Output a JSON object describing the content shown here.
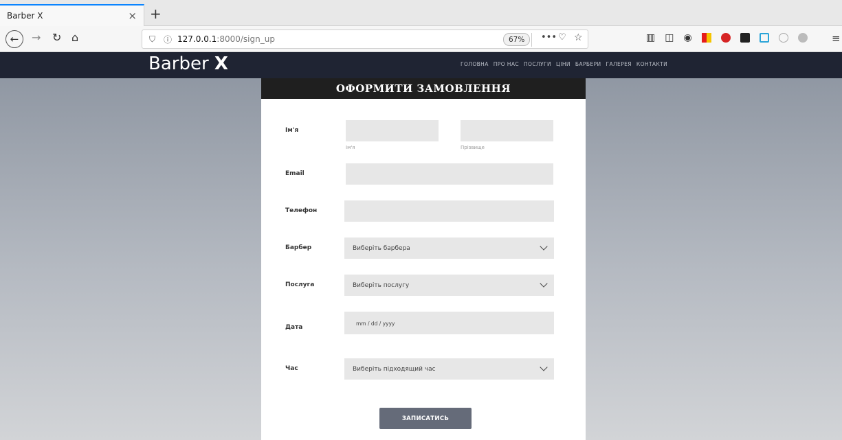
{
  "browser": {
    "tab_title": "Barber X",
    "tab_close": "×",
    "new_tab": "+",
    "url_host": "127.0.0.1",
    "url_path": ":8000/sign_up",
    "zoom": "67%"
  },
  "site": {
    "logo_text": "Barber",
    "logo_mark": "X",
    "nav": [
      "ГОЛОВНА",
      "ПРО НАС",
      "ПОСЛУГИ",
      "ЦІНИ",
      "БАРБЕРИ",
      "ГАЛЕРЕЯ",
      "КОНТАКТИ"
    ]
  },
  "form": {
    "title": "ОФОРМИТИ ЗАМОВЛЕННЯ",
    "name_label": "Ім'я",
    "first_name_hint": "Ім'я",
    "last_name_hint": "Прізвище",
    "email_label": "Email",
    "phone_label": "Телефон",
    "barber_label": "Барбер",
    "barber_placeholder": "Виберіть барбера",
    "service_label": "Послуга",
    "service_placeholder": "Виберіть послугу",
    "date_label": "Дата",
    "date_placeholder": "mm / dd / yyyy",
    "time_label": "Час",
    "time_placeholder": "Виберіть підходящий час",
    "submit_label": "ЗАПИСАТИСЬ"
  },
  "colors": {
    "header_bg": "#1f2433",
    "card_head_bg": "#1f1f1f",
    "button_bg": "#656b79",
    "field_bg": "#e7e7e7"
  }
}
